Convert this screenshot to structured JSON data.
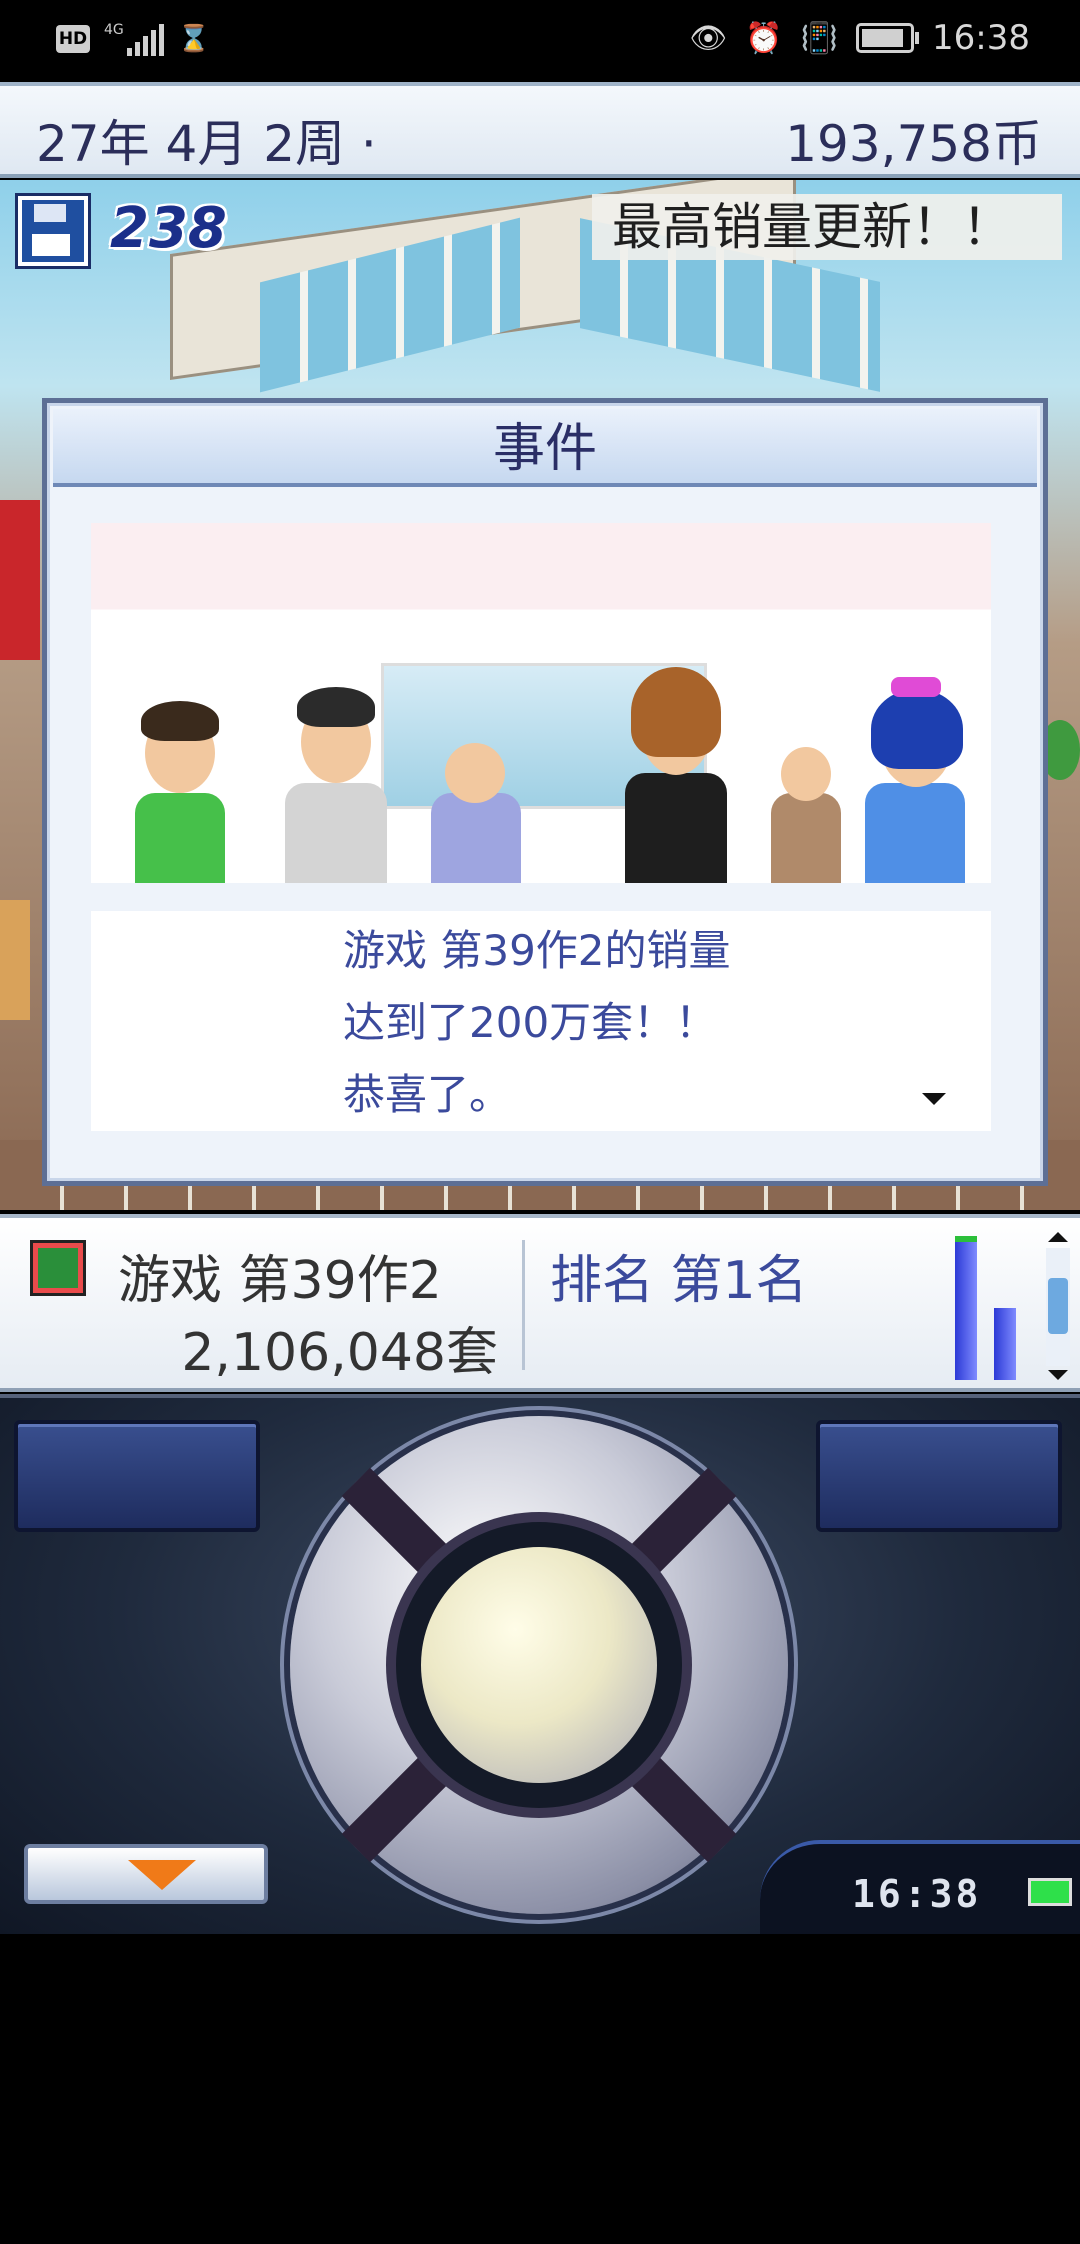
{
  "status_bar": {
    "network_badge": "HD",
    "network_type": "4G",
    "time": "16:38"
  },
  "header": {
    "date": "27年 4月 2周 ·",
    "money": "193,758币"
  },
  "scene": {
    "disk_count": "238",
    "ticker": "最高销量更新！！"
  },
  "event_dialog": {
    "title": "事件",
    "message_lines": [
      "游戏 第39作2的销量",
      "达到了200万套！！",
      "恭喜了。"
    ]
  },
  "info_panel": {
    "game_title": "游戏 第39作2",
    "sales": "2,106,048套",
    "ranking": "排名 第1名"
  },
  "controller": {
    "clock": "16:38"
  },
  "colors": {
    "header_text": "#2b2e5a",
    "message_text": "#3b4a9c",
    "dialog_border": "#5d6f95",
    "menu_arrow": "#f07a18",
    "battery_green": "#2ee04a"
  },
  "icons": [
    "hd-icon",
    "signal-icon",
    "hourglass-icon",
    "eye-icon",
    "alarm-icon",
    "vibrate-icon",
    "battery-icon",
    "floppy-disk-icon",
    "game-cover-icon",
    "dropdown-arrow-icon"
  ]
}
